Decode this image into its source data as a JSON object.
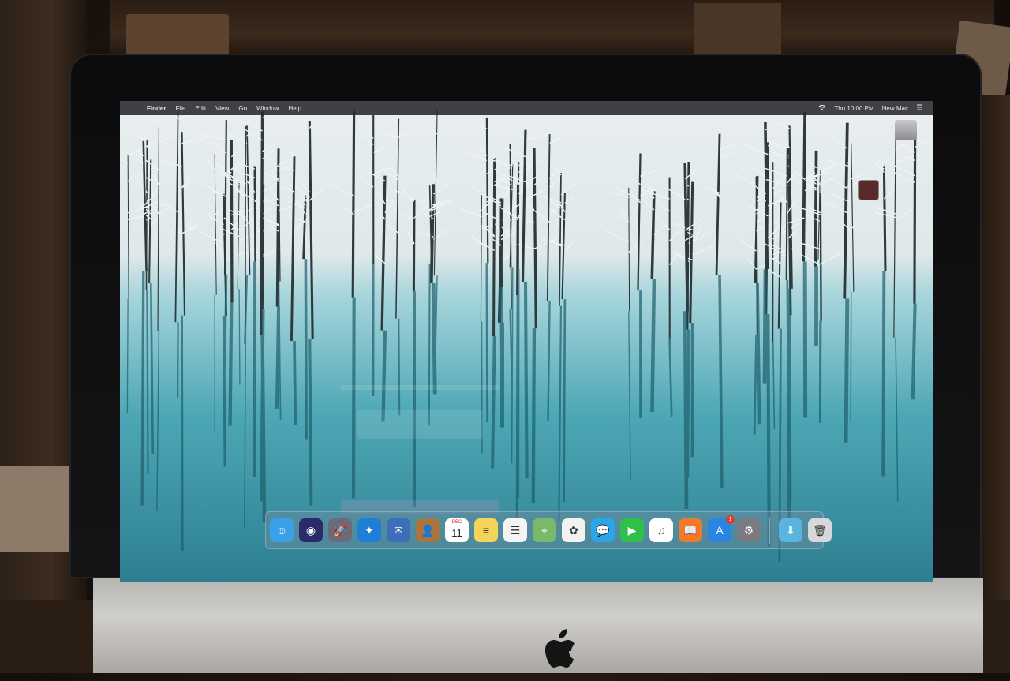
{
  "menubar": {
    "apple_symbol": "",
    "items": [
      {
        "label": "Finder",
        "bold": true
      },
      {
        "label": "File"
      },
      {
        "label": "Edit"
      },
      {
        "label": "View"
      },
      {
        "label": "Go"
      },
      {
        "label": "Window"
      },
      {
        "label": "Help"
      }
    ],
    "wifi_icon": "wifi-icon",
    "clock": "Thu 10:00 PM",
    "user": "New Mac",
    "right_icon": "notification-center-icon"
  },
  "desktop": {
    "icons": [
      {
        "name": "hard-drive-icon"
      },
      {
        "name": "app-shortcut-icon"
      }
    ]
  },
  "dock": {
    "apps": [
      {
        "name": "finder-icon",
        "color": "#3aa0e8",
        "glyph": "☺"
      },
      {
        "name": "siri-icon",
        "color": "#2b2b6b",
        "glyph": "◉"
      },
      {
        "name": "launchpad-icon",
        "color": "#6b6b78",
        "glyph": "🚀"
      },
      {
        "name": "safari-icon",
        "color": "#1f7fd6",
        "glyph": "✦"
      },
      {
        "name": "mail-icon",
        "color": "#3d6fb8",
        "glyph": "✉"
      },
      {
        "name": "contacts-icon",
        "color": "#a8743f",
        "glyph": "👤"
      },
      {
        "name": "calendar-icon",
        "color": "#ffffff",
        "glyph": "",
        "cal_day": "DEC",
        "cal_num": "11"
      },
      {
        "name": "notes-icon",
        "color": "#f4d55a",
        "glyph": "≡"
      },
      {
        "name": "reminders-icon",
        "color": "#f4f4f4",
        "glyph": "☰"
      },
      {
        "name": "maps-icon",
        "color": "#7ab86a",
        "glyph": "⌖"
      },
      {
        "name": "photos-icon",
        "color": "#f2f2f2",
        "glyph": "✿"
      },
      {
        "name": "messages-icon",
        "color": "#2aa6e8",
        "glyph": "💬"
      },
      {
        "name": "facetime-icon",
        "color": "#2fbf4b",
        "glyph": "▶"
      },
      {
        "name": "itunes-icon",
        "color": "#ffffff",
        "glyph": "♫"
      },
      {
        "name": "ibooks-icon",
        "color": "#f07a2a",
        "glyph": "📖"
      },
      {
        "name": "app-store-icon",
        "color": "#2a85e2",
        "glyph": "A",
        "badge": "1"
      },
      {
        "name": "system-preferences-icon",
        "color": "#7a7a80",
        "glyph": "⚙"
      }
    ],
    "right": [
      {
        "name": "downloads-folder-icon",
        "color": "#5ab4e0",
        "glyph": "⬇"
      },
      {
        "name": "trash-icon",
        "color": "#d8d8dc",
        "glyph": "🗑"
      }
    ]
  },
  "colors": {
    "menubar_bg": "#28282e",
    "water_top": "#9fd6dc",
    "water_bottom": "#2f8496",
    "snow": "#eef3f5"
  }
}
